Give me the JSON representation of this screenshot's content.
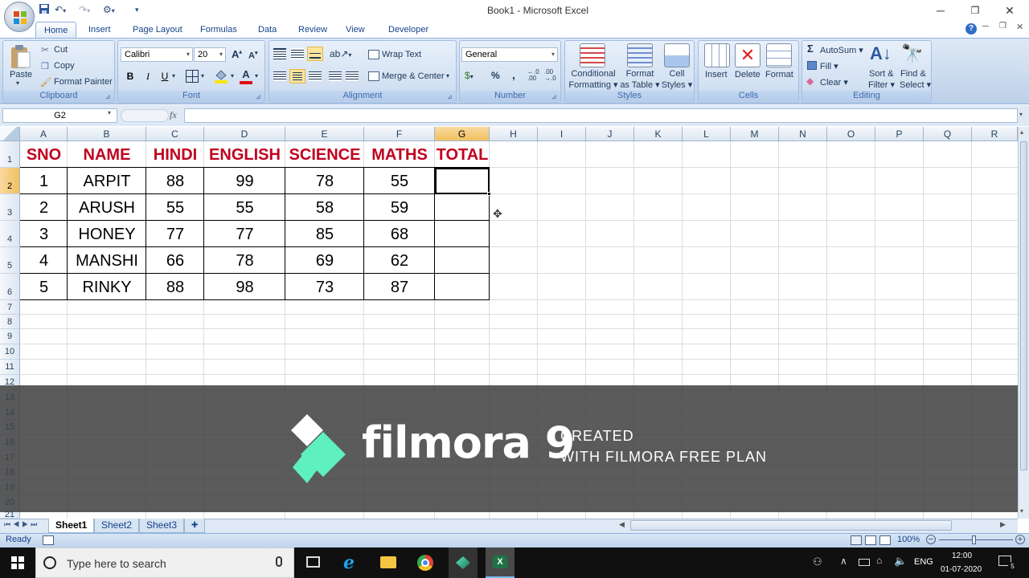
{
  "window": {
    "title": "Book1 - Microsoft Excel"
  },
  "tabs": [
    "Home",
    "Insert",
    "Page Layout",
    "Formulas",
    "Data",
    "Review",
    "View",
    "Developer"
  ],
  "clipboard": {
    "paste": "Paste",
    "cut": "Cut",
    "copy": "Copy",
    "format_painter": "Format Painter",
    "label": "Clipboard"
  },
  "font": {
    "name": "Calibri",
    "size": "20",
    "bold": "B",
    "italic": "I",
    "underline": "U",
    "grow": "A",
    "shrink": "A",
    "color_letter": "A",
    "label": "Font"
  },
  "alignment": {
    "wrap": "Wrap Text",
    "merge": "Merge & Center",
    "label": "Alignment"
  },
  "number": {
    "format": "General",
    "percent": "%",
    "comma": ",",
    "inc_decimals": "←.0\n.00",
    "dec_decimals": ".00\n→.0",
    "label": "Number"
  },
  "styles": {
    "conditional1": "Conditional",
    "conditional2": "Formatting",
    "table1": "Format",
    "table2": "as Table",
    "cell1": "Cell",
    "cell2": "Styles",
    "label": "Styles"
  },
  "cells": {
    "insert": "Insert",
    "delete": "Delete",
    "format": "Format",
    "label": "Cells"
  },
  "editing": {
    "autosum": "AutoSum",
    "fill": "Fill",
    "clear": "Clear",
    "sort1": "Sort &",
    "sort2": "Filter",
    "find1": "Find &",
    "find2": "Select",
    "label": "Editing"
  },
  "name_box": "G2",
  "fx": "fx",
  "columns": [
    "A",
    "B",
    "C",
    "D",
    "E",
    "F",
    "G",
    "H",
    "I",
    "J",
    "K",
    "L",
    "M",
    "N",
    "O",
    "P",
    "Q",
    "R"
  ],
  "rows": [
    "1",
    "2",
    "3",
    "4",
    "5",
    "6",
    "7",
    "8",
    "9",
    "10",
    "11",
    "12",
    "13",
    "14",
    "15",
    "16",
    "17",
    "18",
    "19",
    "20",
    "21"
  ],
  "table": {
    "headers": [
      "SNO",
      "NAME",
      "HINDI",
      "ENGLISH",
      "SCIENCE",
      "MATHS",
      "TOTAL"
    ],
    "rows": [
      [
        "1",
        "ARPIT",
        "88",
        "99",
        "78",
        "55",
        ""
      ],
      [
        "2",
        "ARUSH",
        "55",
        "55",
        "58",
        "59",
        ""
      ],
      [
        "3",
        "HONEY",
        "77",
        "77",
        "85",
        "68",
        ""
      ],
      [
        "4",
        "MANSHI",
        "66",
        "78",
        "69",
        "62",
        ""
      ],
      [
        "5",
        "RINKY",
        "88",
        "98",
        "73",
        "87",
        ""
      ]
    ]
  },
  "watermark": {
    "brand": "filmora 9",
    "line1": "CREATED",
    "line2": "WITH FILMORA FREE PLAN"
  },
  "sheets": [
    "Sheet1",
    "Sheet2",
    "Sheet3"
  ],
  "status": {
    "ready": "Ready",
    "zoom": "100%"
  },
  "taskbar": {
    "search_placeholder": "Type here to search",
    "lang": "ENG",
    "time": "12:00",
    "date": "01-07-2020",
    "notif": "5"
  },
  "colors": {
    "header_red": "#c0001e",
    "ribbon_blue": "#dfe9f5",
    "selection_orange": "#f1c15f",
    "filmora_green": "#5ef0bf"
  }
}
